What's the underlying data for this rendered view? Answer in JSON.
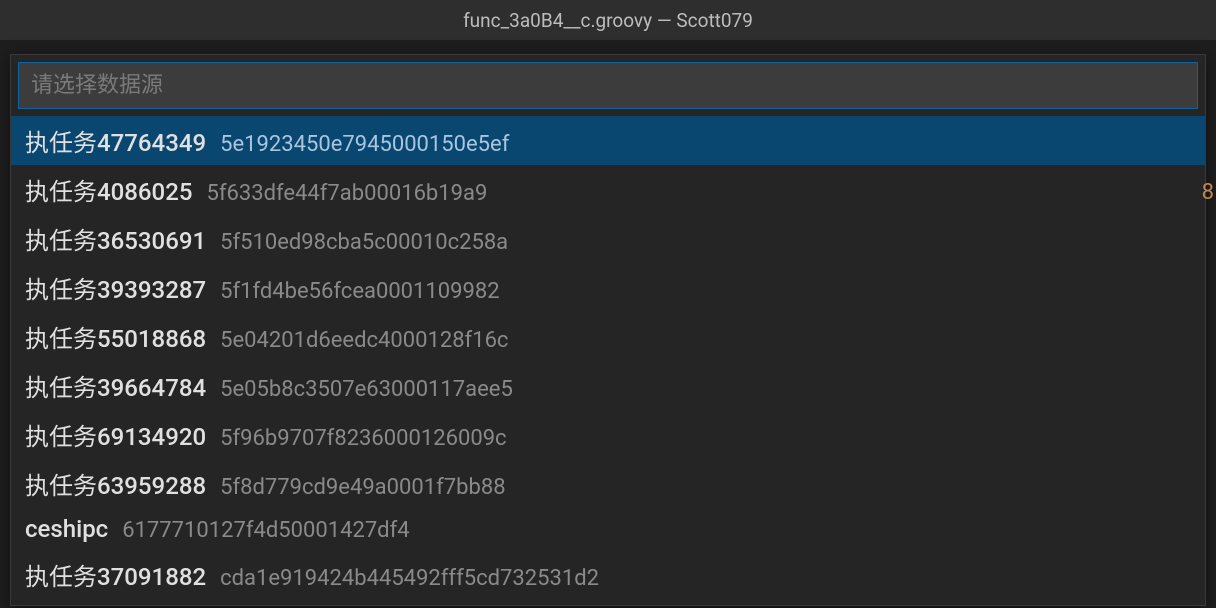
{
  "title": "func_3a0B4__c.groovy — Scott079",
  "search": {
    "placeholder": "请选择数据源",
    "value": ""
  },
  "peek": "8",
  "selected_index": 0,
  "items": [
    {
      "label": "执任务47764349",
      "detail": "5e1923450e7945000150e5ef"
    },
    {
      "label": "执任务4086025",
      "detail": "5f633dfe44f7ab00016b19a9"
    },
    {
      "label": "执任务36530691",
      "detail": "5f510ed98cba5c00010c258a"
    },
    {
      "label": "执任务39393287",
      "detail": "5f1fd4be56fcea0001109982"
    },
    {
      "label": "执任务55018868",
      "detail": "5e04201d6eedc4000128f16c"
    },
    {
      "label": "执任务39664784",
      "detail": "5e05b8c3507e63000117aee5"
    },
    {
      "label": "执任务69134920",
      "detail": "5f96b9707f8236000126009c"
    },
    {
      "label": "执任务63959288",
      "detail": "5f8d779cd9e49a0001f7bb88"
    },
    {
      "label": "ceshipc",
      "detail": "6177710127f4d50001427df4"
    },
    {
      "label": "执任务37091882",
      "detail": "cda1e919424b445492fff5cd732531d2"
    }
  ]
}
